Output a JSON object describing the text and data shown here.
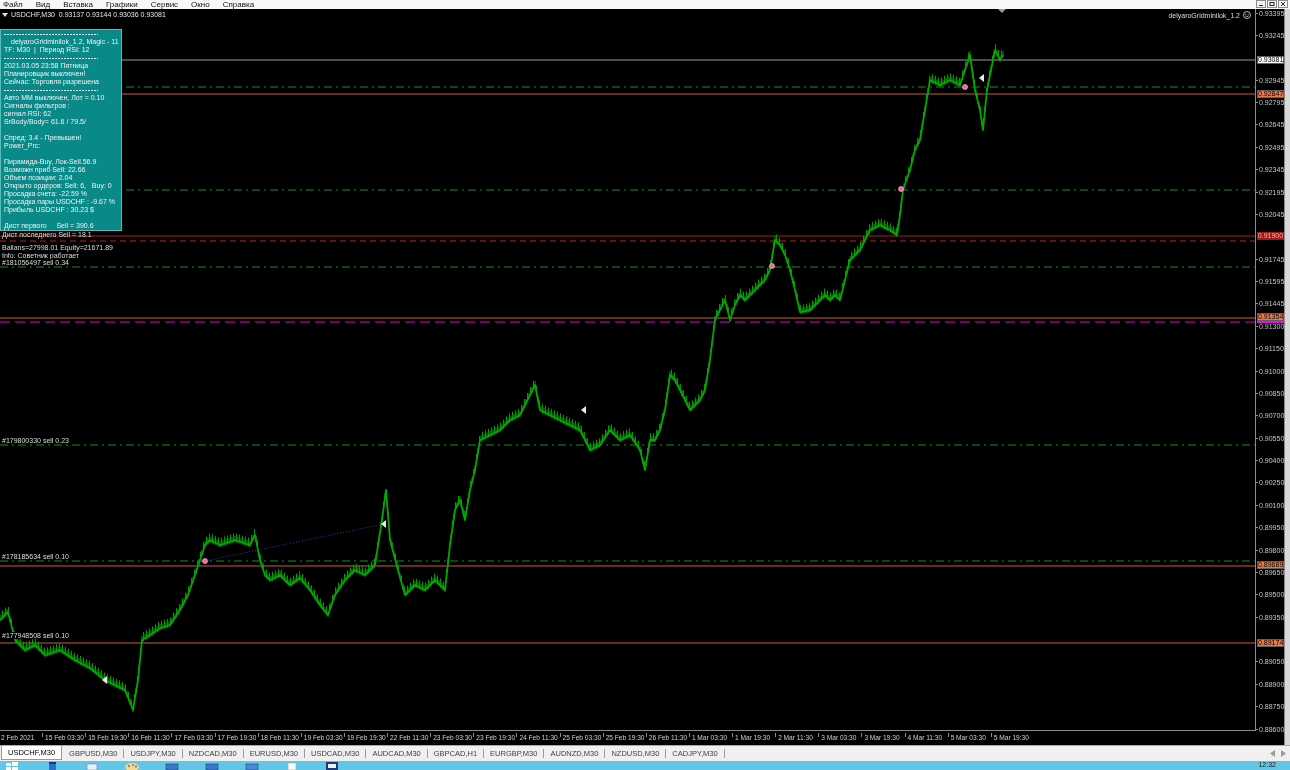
{
  "menu_bar": {
    "items": [
      "Файл",
      "Вид",
      "Вставка",
      "Графики",
      "Сервис",
      "Окно",
      "Справка"
    ]
  },
  "chart": {
    "header": "USDCHF,M30  0.93137 0.93144 0.93036 0.93081",
    "expert_name": "delyaroGridminilok_1.2",
    "info_panel": {
      "groups": [
        {
          "kind": "ruled",
          "lines": [
            "delyaroGridminilok_1.2, Magic - 11",
            "TF: M30  |  Период RSI: 12"
          ]
        },
        {
          "kind": "ruled",
          "lines": [
            "2021.03.05 23:58 Пятница",
            "Планировщик выключен!",
            "Сейчас: Торговля разрешена"
          ]
        },
        {
          "kind": "ruled",
          "lines": [
            "Авто ММ выключен, Лот = 0.10",
            "Сигналы фильтров :",
            "сигнал RSI: 62",
            "SrBody/Body= 61.6 / 79.5/"
          ]
        },
        {
          "kind": "spaced",
          "lines": [
            "Спред: 3.4 - Превышен!",
            "Power_Prc:"
          ]
        },
        {
          "kind": "spaced",
          "lines": [
            "Пирамида-Buy, Лок-Sell.56.9",
            "Возможн приб Sell: 22.66",
            "Объем позиции: 2.04",
            "Открыто ордеров: Sell: 6,   Buy: 0",
            "Просадка счета: -22.59 %",
            "Просадка пары USDCHF : -9.67 %",
            "Прибыль USDCHF : 30.23 $"
          ]
        },
        {
          "kind": "spaced",
          "lines": [
            "Дист первого     Sell = 390.6"
          ]
        }
      ]
    },
    "status_lines": [
      "Дист последнего Sell = 18.1",
      "Ballans=27998.01 Equity=21671.89",
      "Info: Советник работает"
    ],
    "order_labels": [
      "#181056497 sell 0.34",
      "#179800330 sell 0.23",
      "#178185634 sell 0.10",
      "#177948508 sell 0.10"
    ],
    "price_axis": {
      "ticks": [
        "0.93395",
        "0.93245",
        "0.92945",
        "0.92795",
        "0.92645",
        "0.92495",
        "0.92345",
        "0.92195",
        "0.92045",
        "0.91745",
        "0.91595",
        "0.91445",
        "0.91300",
        "0.91150",
        "0.91000",
        "0.90850",
        "0.90700",
        "0.90550",
        "0.90400",
        "0.90250",
        "0.90100",
        "0.89950",
        "0.89800",
        "0.89650",
        "0.89500",
        "0.89350",
        "0.89050",
        "0.88900",
        "0.88750",
        "0.88600"
      ],
      "tags": [
        {
          "label": "0.93081",
          "color": "#ffffff"
        },
        {
          "label": "0.92847",
          "color": "#f07848"
        },
        {
          "label": "0.91900",
          "color": "#a01818"
        },
        {
          "label": "0.91354",
          "color": "#f07848"
        },
        {
          "color": "#ff00ff"
        },
        {
          "label": "0.89689",
          "color": "#f07848"
        },
        {
          "label": "0.89174",
          "color": "#f07848"
        }
      ]
    },
    "time_axis": {
      "labels": [
        "2 Feb 2021",
        "15 Feb 03:30",
        "15 Feb 19:30",
        "16 Feb 11:30",
        "17 Feb 03:30",
        "17 Feb 19:30",
        "18 Feb 11:30",
        "19 Feb 03:30",
        "19 Feb 19:30",
        "22 Feb 11:30",
        "23 Feb 03:30",
        "23 Feb 19:30",
        "24 Feb 11:30",
        "25 Feb 03:30",
        "25 Feb 19:30",
        "26 Feb 11:30",
        "1 Mar 03:30",
        "1 Mar 19:30",
        "2 Mar 11:30",
        "3 Mar 03:30",
        "3 Mar 19:30",
        "4 Mar 11:30",
        "5 Mar 03:30",
        "5 Mar 19:30"
      ]
    }
  },
  "tabs": [
    {
      "label": "USDCHF,M30",
      "selected": true
    },
    {
      "label": "GBPUSD,M30",
      "selected": false
    },
    {
      "label": "USDJPY,M30",
      "selected": false
    },
    {
      "label": "NZDCAD,M30",
      "selected": false
    },
    {
      "label": "EURUSD,M30",
      "selected": false
    },
    {
      "label": "USDCAD,M30",
      "selected": false
    },
    {
      "label": "AUDCAD,M30",
      "selected": false
    },
    {
      "label": "GBPCAD,H1",
      "selected": false
    },
    {
      "label": "EURGBP,M30",
      "selected": false
    },
    {
      "label": "AUDNZD,M30",
      "selected": false
    },
    {
      "label": "NZDUSD,M30",
      "selected": false
    },
    {
      "label": "CADJPY,M30",
      "selected": false
    }
  ],
  "taskbar": {
    "clock": "12:32"
  }
}
